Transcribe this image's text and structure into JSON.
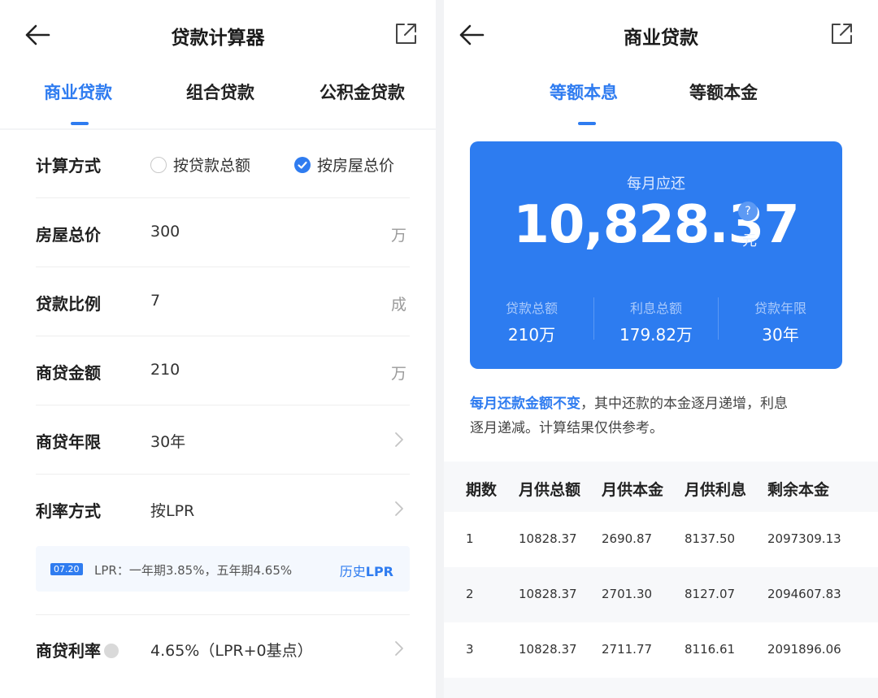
{
  "left": {
    "title": "贷款计算器",
    "tabs": [
      {
        "label": "商业贷款",
        "active": true
      },
      {
        "label": "组合贷款",
        "active": false
      },
      {
        "label": "公积金贷款",
        "active": false
      }
    ],
    "calc_method": {
      "label": "计算方式",
      "options": [
        {
          "label": "按贷款总额",
          "selected": false
        },
        {
          "label": "按房屋总价",
          "selected": true
        }
      ]
    },
    "rows": [
      {
        "label": "房屋总价",
        "value": "300",
        "unit": "万"
      },
      {
        "label": "贷款比例",
        "value": "7",
        "unit": "成"
      },
      {
        "label": "商贷金额",
        "value": "210",
        "unit": "万"
      },
      {
        "label": "商贷年限",
        "value": "30年"
      },
      {
        "label": "利率方式",
        "value": "按LPR"
      }
    ],
    "lpr": {
      "date": "07.20",
      "text": "LPR：一年期3.85%，五年期4.65%",
      "history_prefix": "历史",
      "history_suffix": "LPR"
    },
    "rate": {
      "label": "商贷利率",
      "value": "4.65%（LPR+0基点）"
    }
  },
  "right": {
    "title": "商业贷款",
    "tabs": [
      {
        "label": "等额本息",
        "active": true
      },
      {
        "label": "等额本金",
        "active": false
      }
    ],
    "card": {
      "monthly_label": "每月应还",
      "monthly_amount": "10,828.37",
      "help": "?",
      "unit": "元",
      "stats": [
        {
          "label": "贷款总额",
          "value": "210万"
        },
        {
          "label": "利息总额",
          "value": "179.82万"
        },
        {
          "label": "贷款年限",
          "value": "30年"
        }
      ]
    },
    "note_highlight": "每月还款金额不变",
    "note_line1_rest": "，其中还款的本金逐月递增，利息",
    "note_line2": "逐月递减。计算结果仅供参考。",
    "table": {
      "headers": [
        "期数",
        "月供总额",
        "月供本金",
        "月供利息",
        "剩余本金"
      ],
      "rows": [
        [
          "1",
          "10828.37",
          "2690.87",
          "8137.50",
          "2097309.13"
        ],
        [
          "2",
          "10828.37",
          "2701.30",
          "8127.07",
          "2094607.83"
        ],
        [
          "3",
          "10828.37",
          "2711.77",
          "8116.61",
          "2091896.06"
        ]
      ]
    }
  },
  "colors": {
    "accent": "#2f7cf0",
    "card_bg": "#2d7cf0",
    "row_alt": "#f7f8fa"
  },
  "icons": [
    "back-arrow-icon",
    "share-icon",
    "chevron-right-icon",
    "radio-check-icon",
    "info-icon"
  ]
}
